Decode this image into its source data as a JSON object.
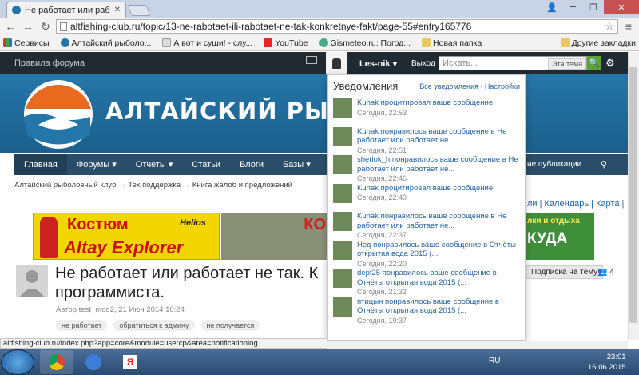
{
  "browser": {
    "tab_title": "Не работает или работа",
    "url": "altfishing-club.ru/topic/13-ne-rabotaet-ili-rabotaet-ne-tak-konkretnye-fakt/page-55#entry165776",
    "bookmarks": [
      "Сервисы",
      "Алтайский рыболо...",
      "А вот и суши! - слу...",
      "YouTube",
      "Gismeteo.ru: Погод...",
      "Новая папка"
    ],
    "other_bookmarks": "Другие закладки",
    "status_url": "altfishing-club.ru/index.php?app=core&module=usercp&area=notificationlog"
  },
  "forum": {
    "rules": "Правила форума",
    "username": "Les-nik",
    "logout": "Выход",
    "search_placeholder": "Искать...",
    "search_scope": "Эта тема",
    "site_title": "АЛТАЙСКИЙ РЫБОЛО",
    "nav": [
      "Главная",
      "Форумы",
      "Отчеты",
      "Статьи",
      "Блоги",
      "Базы"
    ],
    "nav_right": "ие публикации",
    "breadcrumbs": [
      "Алтайский рыболовный клуб",
      "Тех поддержка",
      "Книга жалоб и предложений"
    ],
    "right_links": "ли | Календарь | Карта |",
    "banner1_line1": "Костюм",
    "banner1_line2": "Altay Explorer",
    "banner1_brand": "Helios",
    "banner2_text": "КО",
    "banner3_line1": "лки и отдыха",
    "banner3_line2": "КУДА",
    "topic_title": "Не работает или работает не так. К программиста.",
    "topic_meta": "Автор test_mod2, 21 Июн 2014 16:24",
    "tags": [
      "не работает",
      "обратиться к админу",
      "не получается"
    ],
    "subscribe": "Подписка на тему",
    "followers": "4"
  },
  "notifications": {
    "title": "Уведомления",
    "links": "Все уведомления · Настройки",
    "items": [
      {
        "text": "Kunak процитировал ваше сообщение",
        "time": "Сегодня, 22:53"
      },
      {
        "text": "Kunak понравилось ваше сообщение в Не работает или работает не...",
        "time": "Сегодня, 22:51"
      },
      {
        "text": "sherlok_h понравилось ваше сообщение в Не работает или работает не...",
        "time": "Сегодня, 22:46"
      },
      {
        "text": "Kunak процитировал ваше сообщение",
        "time": "Сегодня, 22:40"
      },
      {
        "text": "Kunak понравилось ваше сообщение в Не работает или работает не...",
        "time": "Сегодня, 22:37"
      },
      {
        "text": "Нед понравилось ваше сообщение в Отчёты открытая вода 2015 (...",
        "time": "Сегодня, 22:20"
      },
      {
        "text": "dept25 понравилось ваше сообщение в Отчёты открытая вода 2015 (...",
        "time": "Сегодня, 21:32"
      },
      {
        "text": "птицын понравилось ваше сообщение в Отчёты открытая вода 2015 (...",
        "time": "Сегодня, 19:37"
      }
    ]
  },
  "taskbar": {
    "lang": "RU",
    "time": "23:01",
    "date": "16.06.2015"
  },
  "colors": {
    "header_blue": "#2576a8",
    "nav_dark": "#2b4e68",
    "search_green": "#5aa43a",
    "link_blue": "#2563a3"
  }
}
